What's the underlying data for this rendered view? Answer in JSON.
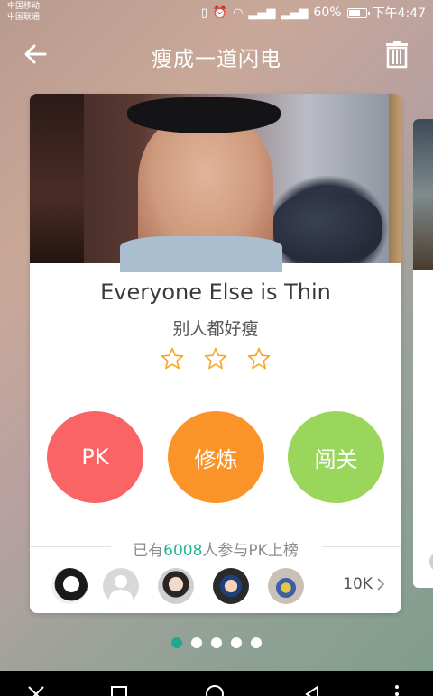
{
  "status_bar": {
    "carrier_1": "中国移动",
    "carrier_2": "中国联通",
    "battery": "60%",
    "time": "下午4:47"
  },
  "header": {
    "title": "瘦成一道闪电"
  },
  "card": {
    "title_en": "Everyone Else is Thin",
    "title_cn": "别人都好瘦",
    "stars": 3,
    "buttons": {
      "pk": "PK",
      "practice": "修炼",
      "challenge": "闯关"
    },
    "participants": {
      "prefix": "已有",
      "count": "6008",
      "suffix": "人参与PK上榜"
    },
    "more_count": "10K"
  },
  "pager": {
    "total": 5,
    "active": 0
  },
  "colors": {
    "pk": "#fb6465",
    "practice": "#fb9428",
    "challenge": "#9ad65c",
    "accent": "#1fa88f",
    "star": "#f5a623"
  }
}
